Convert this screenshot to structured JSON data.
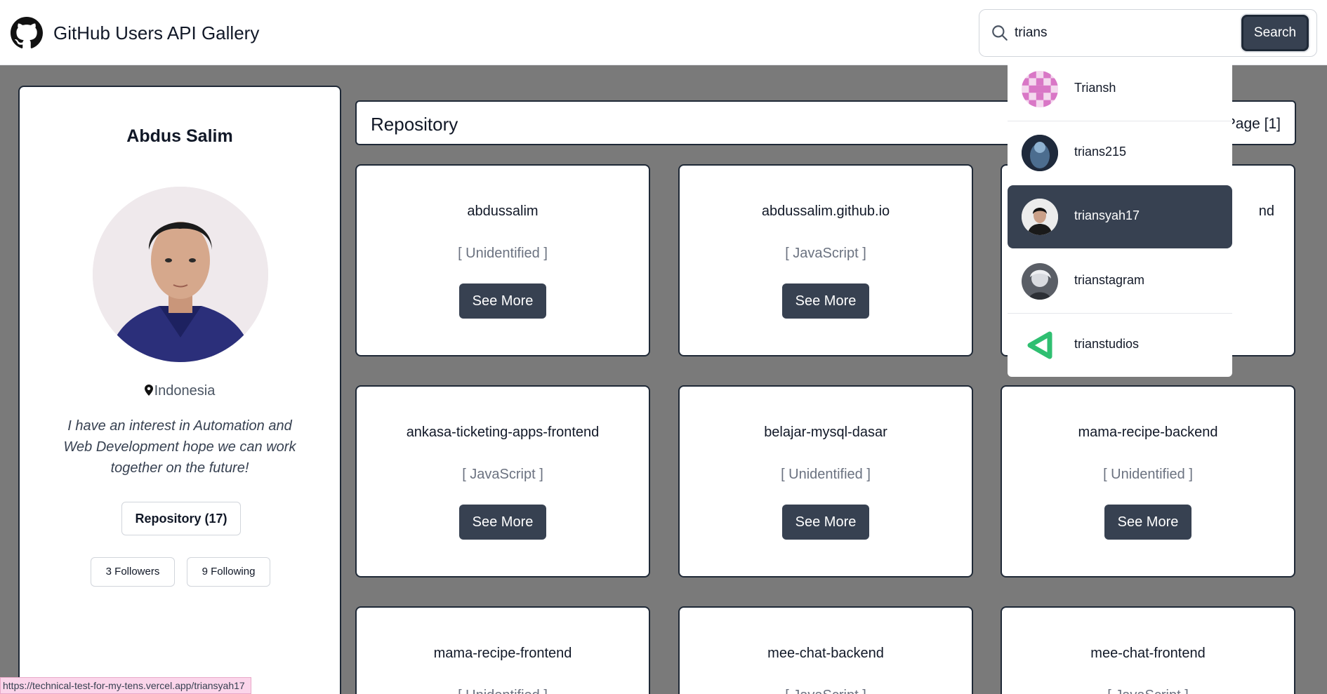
{
  "header": {
    "title": "GitHub Users API Gallery",
    "logo_icon": "github-octocat-icon",
    "search": {
      "value": "trians",
      "placeholder": "",
      "button_label": "Search"
    }
  },
  "profile": {
    "name": "Abdus Salim",
    "location": "Indonesia",
    "bio": "I have an interest in Automation and Web Development hope we can work together on the future!",
    "repository_button": "Repository (17)",
    "followers": "3 Followers",
    "following": "9 Following"
  },
  "repositories": {
    "title": "Repository",
    "page": "Page [1]",
    "button_label": "See More",
    "items": [
      {
        "name": "abdussalim",
        "language": "[ Unidentified ]"
      },
      {
        "name": "abdussalim.github.io",
        "language": "[ JavaScript ]"
      },
      {
        "name": "nd",
        "language": ""
      },
      {
        "name": "ankasa-ticketing-apps-frontend",
        "language": "[ JavaScript ]"
      },
      {
        "name": "belajar-mysql-dasar",
        "language": "[ Unidentified ]"
      },
      {
        "name": "mama-recipe-backend",
        "language": "[ Unidentified ]"
      },
      {
        "name": "mama-recipe-frontend",
        "language": "[ Unidentified ]"
      },
      {
        "name": "mee-chat-backend",
        "language": "[ JavaScript ]"
      },
      {
        "name": "mee-chat-frontend",
        "language": "[ JavaScript ]"
      }
    ]
  },
  "search_results": [
    {
      "login": "Triansh",
      "active": false
    },
    {
      "login": "trians215",
      "active": false
    },
    {
      "login": "triansyah17",
      "active": true
    },
    {
      "login": "trianstagram",
      "active": false
    },
    {
      "login": "trianstudios",
      "active": false
    }
  ],
  "colors": {
    "primary": "#374151",
    "backdrop": "#7a7a7a",
    "accent_green": "#2fbf71"
  },
  "status_bar": {
    "url": "https://technical-test-for-my-tens.vercel.app/triansyah17"
  }
}
